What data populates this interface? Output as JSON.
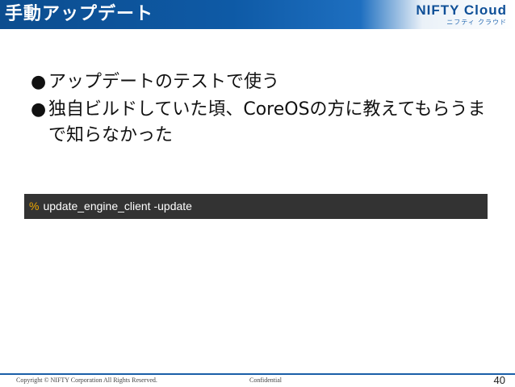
{
  "slide": {
    "title": "手動アップデート"
  },
  "logo": {
    "main": "NIFTY Cloud",
    "sub": "ニフティ クラウド"
  },
  "bullets": [
    {
      "marker": "●",
      "text": "アップデートのテストで使う"
    },
    {
      "marker": "●",
      "text": "独自ビルドしていた頃、CoreOSの方に教えてもらうまで知らなかった"
    }
  ],
  "command": {
    "prompt": "%",
    "text": "update_engine_client -update"
  },
  "footer": {
    "copyright": "Copyright © NIFTY Corporation All Rights Reserved.",
    "confidential": "Confidential",
    "page_number": "40"
  },
  "colors": {
    "header_blue": "#0e5aa6",
    "logo_blue": "#0e4f97",
    "command_background": "#333333",
    "prompt_orange": "#f0a800",
    "footer_line": "#1a5fa8"
  }
}
